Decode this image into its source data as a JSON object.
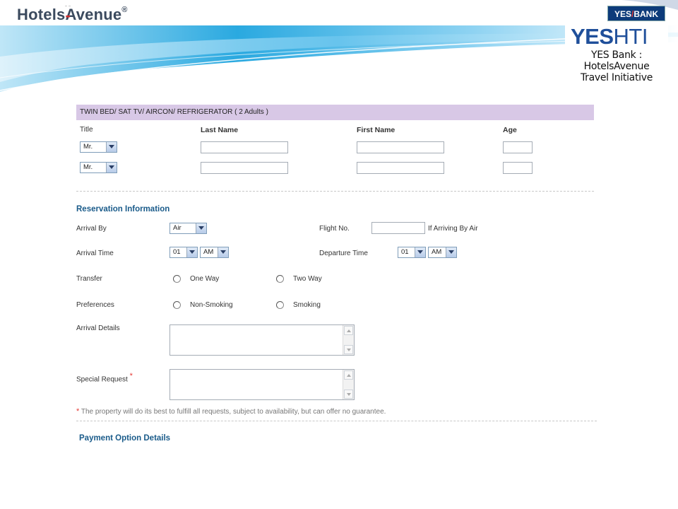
{
  "header": {
    "logo_text": "Hotels",
    "logo_dash": "-",
    "logo_text2": "Avenue",
    "logo_reg": "®",
    "yes_bank_yes": "YES",
    "yes_bank_bank": "BANK",
    "yeshti_yes": "YES",
    "yeshti_hti": "HTI",
    "yeshti_line1": "YES Bank : HotelsAvenue",
    "yeshti_line2": "Travel Initiative"
  },
  "room": {
    "header": "TWIN BED/ SAT TV/ AIRCON/ REFRIGERATOR ( 2 Adults )",
    "col_title": "Title",
    "col_last": "Last Name",
    "col_first": "First Name",
    "col_age": "Age",
    "guests": [
      {
        "title": "Mr."
      },
      {
        "title": "Mr."
      }
    ]
  },
  "reservation": {
    "heading": "Reservation Information",
    "arrival_by_label": "Arrival By",
    "arrival_by_value": "Air",
    "flight_label": "Flight No.",
    "flight_hint": "If Arriving By Air",
    "arrival_time_label": "Arrival Time",
    "arrival_hour": "01",
    "arrival_ampm": "AM",
    "departure_time_label": "Departure Time",
    "departure_hour": "01",
    "departure_ampm": "AM",
    "transfer_label": "Transfer",
    "transfer_one": "One Way",
    "transfer_two": "Two Way",
    "pref_label": "Preferences",
    "pref_non": "Non-Smoking",
    "pref_smoke": "Smoking",
    "arrival_details_label": "Arrival Details",
    "special_request_label": "Special Request",
    "required_mark": "*",
    "note": "The property will do its best to fulfill all requests, subject to availability, but can offer no guarantee."
  },
  "payment": {
    "heading": "Payment Option Details"
  },
  "colors": {
    "room_header_bg": "#d8c8e6",
    "section_heading": "#1a5b8a",
    "required": "#e53935",
    "brand_blue": "#1f4f9a"
  }
}
